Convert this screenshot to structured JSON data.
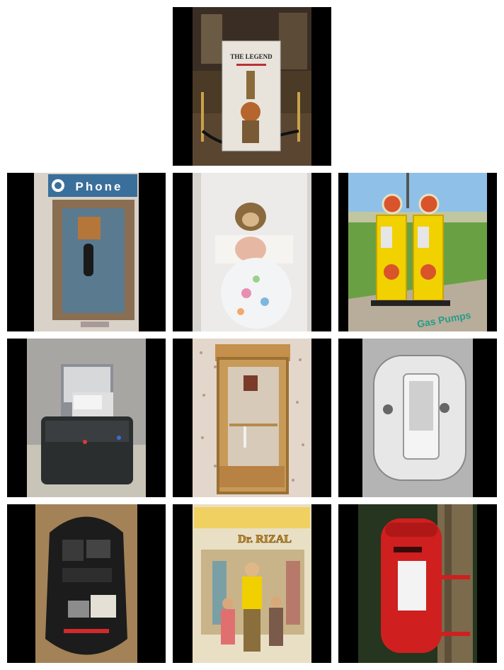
{
  "images": [
    {
      "subject": "museum-display",
      "sign_text": "THE LEGEND"
    },
    {
      "subject": "payphone",
      "sign_text": "Phone"
    },
    {
      "subject": "baby-in-crib"
    },
    {
      "subject": "gas-pumps",
      "caption": "Gas Pumps"
    },
    {
      "subject": "hard-drive-dock"
    },
    {
      "subject": "wall-cabinet"
    },
    {
      "subject": "light-switch"
    },
    {
      "subject": "camera-backpack"
    },
    {
      "subject": "comic-cover",
      "cover_text": "Dr. RIZAL"
    },
    {
      "subject": "post-box"
    }
  ],
  "colors": {
    "background": "#ffffff",
    "letterbox": "#000000"
  }
}
